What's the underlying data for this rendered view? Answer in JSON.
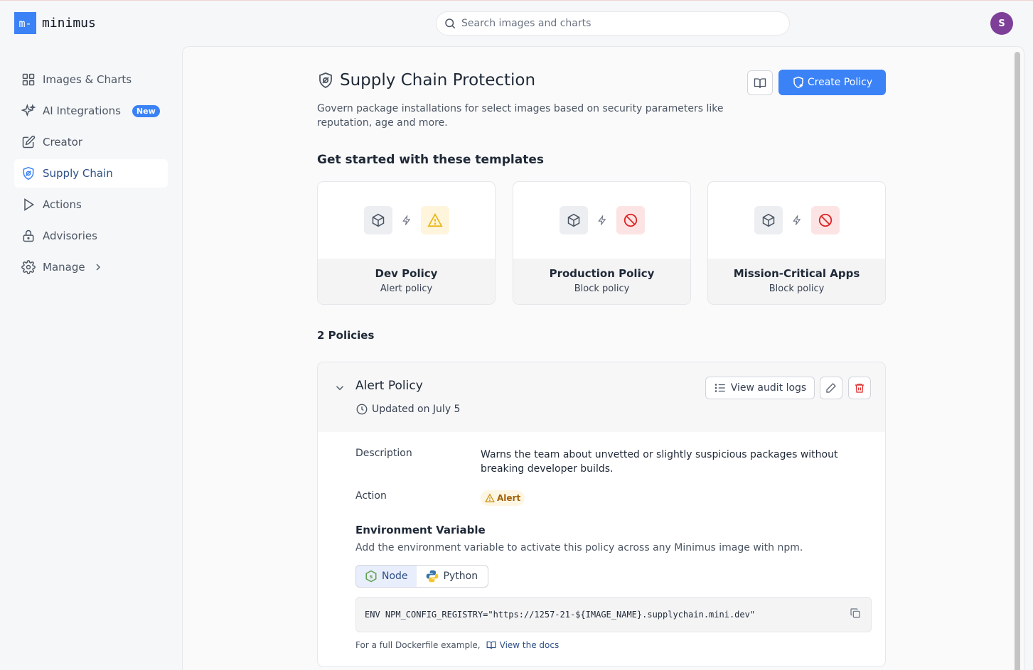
{
  "app": {
    "logo_mark": "m-",
    "logo_text": "minimus",
    "user_initial": "S"
  },
  "search": {
    "placeholder": "Search images and charts"
  },
  "sidebar": {
    "items": [
      {
        "label": "Images & Charts",
        "icon": "grid-icon"
      },
      {
        "label": "AI Integrations",
        "icon": "sparkles-icon",
        "badge": "New"
      },
      {
        "label": "Creator",
        "icon": "edit-icon"
      },
      {
        "label": "Supply Chain",
        "icon": "shield-icon",
        "active": true
      },
      {
        "label": "Actions",
        "icon": "play-icon"
      },
      {
        "label": "Advisories",
        "icon": "lock-icon"
      },
      {
        "label": "Manage",
        "icon": "gear-icon"
      }
    ]
  },
  "page": {
    "title": "Supply Chain Protection",
    "subtitle": "Govern package installations for select images based on security parameters like reputation, age and more.",
    "create_label": "Create Policy",
    "templates_title": "Get started with these templates",
    "templates": [
      {
        "name": "Dev Policy",
        "type": "Alert policy",
        "status_icon": "warning-icon"
      },
      {
        "name": "Production Policy",
        "type": "Block policy",
        "status_icon": "block-icon"
      },
      {
        "name": "Mission-Critical Apps",
        "type": "Block policy",
        "status_icon": "block-icon"
      }
    ],
    "policies_count": "2 Policies"
  },
  "policy": {
    "name": "Alert Policy",
    "updated": "Updated on July 5",
    "audit_label": "View audit logs",
    "description_label": "Description",
    "description": "Warns the team about unvetted or slightly suspicious packages without breaking developer builds.",
    "action_label": "Action",
    "action_value": "Alert",
    "env_title": "Environment Variable",
    "env_desc": "Add the environment variable to activate this policy across any Minimus image with npm.",
    "tabs": [
      "Node",
      "Python"
    ],
    "code": "ENV NPM_CONFIG_REGISTRY=\"https://1257-21-${IMAGE_NAME}.supplychain.mini.dev\"",
    "docs_prefix": "For a full Dockerfile example,",
    "docs_link": "View the docs"
  },
  "colors": {
    "accent": "#3b82f6",
    "avatar": "#7e3f98",
    "alert": "#a16207",
    "block": "#dc2626"
  }
}
